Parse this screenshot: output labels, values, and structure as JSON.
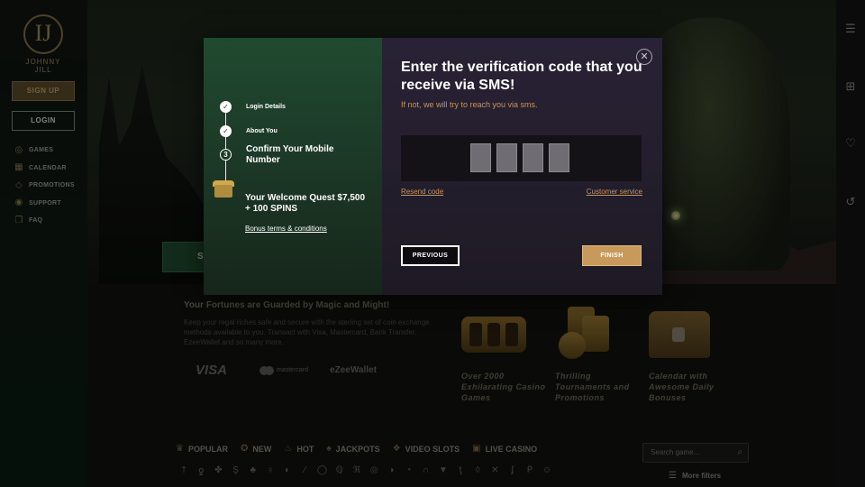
{
  "brand": {
    "logo_glyph": "IJ",
    "logo_text": "JOHNNY JILL"
  },
  "sidebar": {
    "signup_label": "SIGN UP",
    "login_label": "LOGIN",
    "items": [
      {
        "label": "GAMES",
        "icon": "gamepad-icon"
      },
      {
        "label": "CALENDAR",
        "icon": "calendar-icon"
      },
      {
        "label": "PROMOTIONS",
        "icon": "diamond-icon"
      },
      {
        "label": "SUPPORT",
        "icon": "support-icon"
      },
      {
        "label": "FAQ",
        "icon": "faq-icon"
      }
    ]
  },
  "rightbar": {
    "icons": [
      "filters-icon",
      "gift-icon",
      "heart-icon",
      "history-icon"
    ]
  },
  "hero": {
    "cta_label": "SI"
  },
  "fortunes": {
    "title": "Your Fortunes are Guarded by Magic and Might!",
    "text": "Keep your regal riches safe and secure with the sterling set of coin exchange methods available to you. Transact with Visa, Mastercard, Bank Transfer, EzeeWallet and so many more.",
    "payments": {
      "visa": "VISA",
      "mastercard": "mastercard",
      "ezee": "eZeeWallet"
    }
  },
  "features": [
    {
      "label": "Over 2000 Exhilarating Casino Games",
      "icon": "slot-machine-icon"
    },
    {
      "label": "Thrilling Tournaments and Promotions",
      "icon": "coins-icon"
    },
    {
      "label": "Calendar with Awesome Daily Bonuses",
      "icon": "treasure-chest-icon"
    }
  ],
  "categories": [
    {
      "label": "POPULAR",
      "icon": "trophy-icon"
    },
    {
      "label": "NEW",
      "icon": "new-icon"
    },
    {
      "label": "HOT",
      "icon": "flame-icon"
    },
    {
      "label": "JACKPOTS",
      "icon": "jackpot-icon"
    },
    {
      "label": "VIDEO SLOTS",
      "icon": "video-slots-icon"
    },
    {
      "label": "LIVE CASINO",
      "icon": "live-casino-icon"
    }
  ],
  "search": {
    "placeholder": "Search game..."
  },
  "more_filters_label": "More filters",
  "modal": {
    "steps": [
      {
        "label": "Login Details",
        "state": "done"
      },
      {
        "label": "About You",
        "state": "done"
      },
      {
        "label": "Confirm Your Mobile Number",
        "state": "current",
        "number": "3"
      }
    ],
    "quest_title": "Your Welcome Quest $7,500 + 100 SPINS",
    "bonus_link": "Bonus terms & conditions",
    "title": "Enter the verification code that you receive via SMS!",
    "subtitle": "If not, we will try to reach you via sms.",
    "resend_label": "Resend code",
    "service_label": "Customer service",
    "previous_label": "PREVIOUS",
    "finish_label": "FINISH",
    "colors": {
      "accent": "#c79a5c",
      "left_panel": "#1f4a2e",
      "right_panel": "#262030"
    }
  }
}
